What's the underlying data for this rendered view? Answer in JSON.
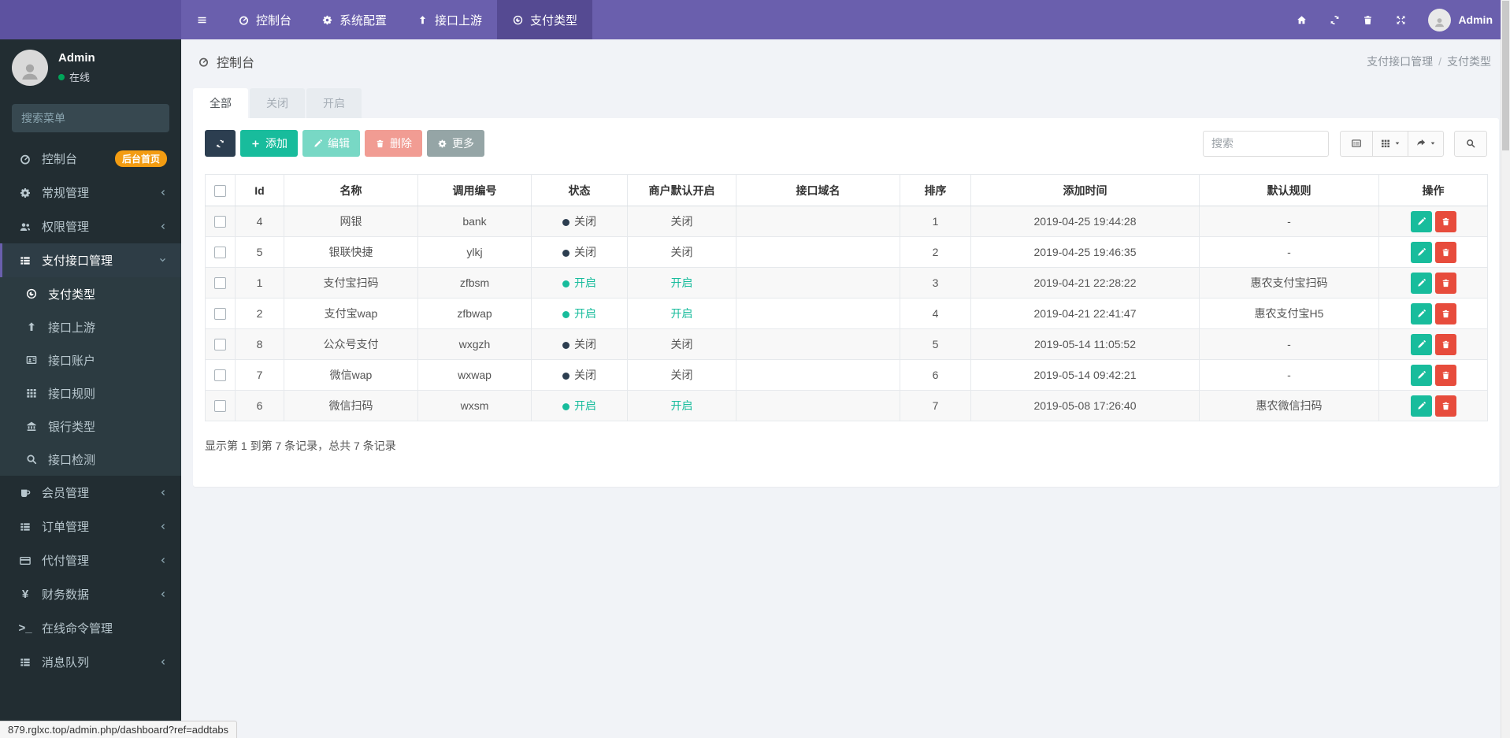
{
  "colors": {
    "accent_purple": "#6a5fad",
    "teal_success": "#18bc9c",
    "red_danger": "#e74c3c",
    "navy_dark": "#2c3e50",
    "orange_badge": "#f39c12",
    "sidebar_bg": "#222d32"
  },
  "navbar": {
    "menu": [
      {
        "icon": "bars",
        "label": "",
        "active": false
      },
      {
        "icon": "gauge",
        "label": "控制台",
        "active": false
      },
      {
        "icon": "gear",
        "label": "系统配置",
        "active": false
      },
      {
        "icon": "up",
        "label": "接口上游",
        "active": false
      },
      {
        "icon": "pay",
        "label": "支付类型",
        "active": true
      }
    ],
    "right_icons": [
      "home",
      "refresh",
      "trash",
      "expand"
    ],
    "username": "Admin"
  },
  "sidebar": {
    "username": "Admin",
    "status": "在线",
    "search_placeholder": "搜索菜单",
    "menu": [
      {
        "icon": "gauge",
        "label": "控制台",
        "badge": "后台首页"
      },
      {
        "icon": "gear",
        "label": "常规管理",
        "chevron": "left"
      },
      {
        "icon": "users",
        "label": "权限管理",
        "chevron": "left"
      },
      {
        "icon": "list",
        "label": "支付接口管理",
        "chevron": "down",
        "active": true,
        "children": [
          {
            "icon": "pay",
            "label": "支付类型",
            "active": true
          },
          {
            "icon": "up",
            "label": "接口上游"
          },
          {
            "icon": "idcard",
            "label": "接口账户"
          },
          {
            "icon": "grid",
            "label": "接口规则"
          },
          {
            "icon": "bank",
            "label": "银行类型"
          },
          {
            "icon": "search",
            "label": "接口检测"
          }
        ]
      },
      {
        "icon": "mug",
        "label": "会员管理",
        "chevron": "left"
      },
      {
        "icon": "list",
        "label": "订单管理",
        "chevron": "left"
      },
      {
        "icon": "card",
        "label": "代付管理",
        "chevron": "left"
      },
      {
        "icon": "yen",
        "label": "财务数据",
        "chevron": "left",
        "text_icon": "¥"
      },
      {
        "icon": "term",
        "label": "在线命令管理",
        "text_icon": ">_"
      },
      {
        "icon": "list",
        "label": "消息队列",
        "chevron": "left"
      }
    ]
  },
  "header": {
    "title": "控制台",
    "breadcrumb": [
      "支付接口管理",
      "支付类型"
    ]
  },
  "tabs": [
    {
      "label": "全部",
      "active": true
    },
    {
      "label": "关闭",
      "active": false
    },
    {
      "label": "开启",
      "active": false
    }
  ],
  "toolbar": {
    "add_label": "添加",
    "edit_label": "编辑",
    "delete_label": "删除",
    "more_label": "更多",
    "search_placeholder": "搜索"
  },
  "table": {
    "columns": [
      "Id",
      "名称",
      "调用编号",
      "状态",
      "商户默认开启",
      "接口域名",
      "排序",
      "添加时间",
      "默认规则",
      "操作"
    ],
    "on_label": "开启",
    "off_label": "关闭",
    "rows": [
      {
        "id": "4",
        "name": "网银",
        "code": "bank",
        "status": "关闭",
        "merchant": "关闭",
        "domain": "",
        "sort": "1",
        "time": "2019-04-25 19:44:28",
        "rule": "-"
      },
      {
        "id": "5",
        "name": "银联快捷",
        "code": "ylkj",
        "status": "关闭",
        "merchant": "关闭",
        "domain": "",
        "sort": "2",
        "time": "2019-04-25 19:46:35",
        "rule": "-"
      },
      {
        "id": "1",
        "name": "支付宝扫码",
        "code": "zfbsm",
        "status": "开启",
        "merchant": "开启",
        "domain": "",
        "sort": "3",
        "time": "2019-04-21 22:28:22",
        "rule": "惠农支付宝扫码"
      },
      {
        "id": "2",
        "name": "支付宝wap",
        "code": "zfbwap",
        "status": "开启",
        "merchant": "开启",
        "domain": "",
        "sort": "4",
        "time": "2019-04-21 22:41:47",
        "rule": "惠农支付宝H5"
      },
      {
        "id": "8",
        "name": "公众号支付",
        "code": "wxgzh",
        "status": "关闭",
        "merchant": "关闭",
        "domain": "",
        "sort": "5",
        "time": "2019-05-14 11:05:52",
        "rule": "-"
      },
      {
        "id": "7",
        "name": "微信wap",
        "code": "wxwap",
        "status": "关闭",
        "merchant": "关闭",
        "domain": "",
        "sort": "6",
        "time": "2019-05-14 09:42:21",
        "rule": "-"
      },
      {
        "id": "6",
        "name": "微信扫码",
        "code": "wxsm",
        "status": "开启",
        "merchant": "开启",
        "domain": "",
        "sort": "7",
        "time": "2019-05-08 17:26:40",
        "rule": "惠农微信扫码"
      }
    ],
    "summary": "显示第 1 到第 7 条记录，总共 7 条记录"
  },
  "statusbar": {
    "url": "879.rglxc.top/admin.php/dashboard?ref=addtabs"
  }
}
